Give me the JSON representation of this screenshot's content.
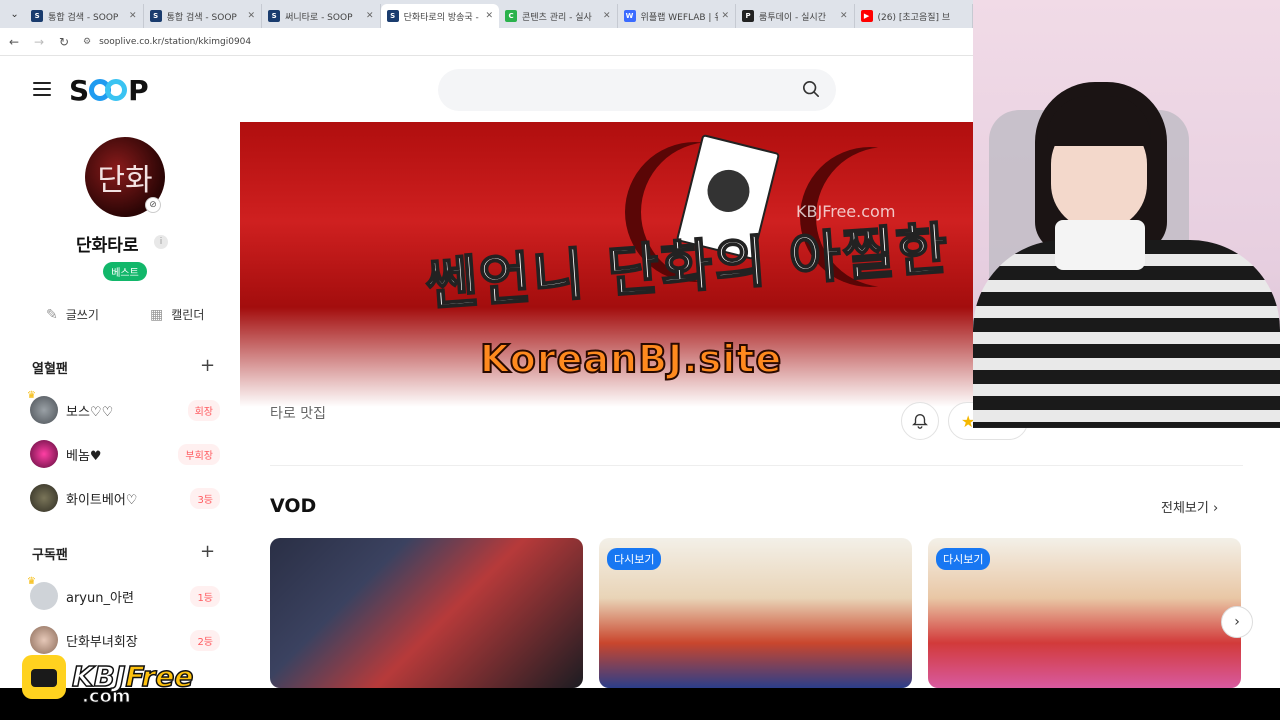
{
  "browser": {
    "tabs": [
      {
        "title": "통합 검색 - SOOP",
        "fav_color": "#1a3c6e",
        "fav_text": "S"
      },
      {
        "title": "통합 검색 - SOOP",
        "fav_color": "#1a3c6e",
        "fav_text": "S"
      },
      {
        "title": "써니타로 - SOOP",
        "fav_color": "#1a3c6e",
        "fav_text": "S"
      },
      {
        "title": "단화타로의 방송국 -",
        "fav_color": "#1a3c6e",
        "fav_text": "S"
      },
      {
        "title": "콘텐츠 관리 - 실사",
        "fav_color": "#2bb24c",
        "fav_text": "C"
      },
      {
        "title": "위플랩 WEFLAB | 유",
        "fav_color": "#3b6bff",
        "fav_text": "W"
      },
      {
        "title": "룸투데이 - 실시간",
        "fav_color": "#222222",
        "fav_text": "P"
      },
      {
        "title": "(26) [초고음질] 브",
        "fav_color": "#ff0000",
        "fav_text": "▶"
      }
    ],
    "url": "sooplive.co.kr/station/kkimgi0904"
  },
  "header": {
    "logo_text_s": "S",
    "logo_text_p": "P"
  },
  "profile": {
    "avatar_text": "단화",
    "name": "단화타로",
    "badge": "베스트",
    "write_label": "글쓰기",
    "calendar_label": "캘린더"
  },
  "fan_sections": {
    "hot_title": "열혈팬",
    "hot_members": [
      {
        "name": "보스♡♡",
        "rank": "회장"
      },
      {
        "name": "베놈♥",
        "rank": "부회장"
      },
      {
        "name": "화이트베어♡",
        "rank": "3등"
      }
    ],
    "sub_title": "구독팬",
    "sub_members": [
      {
        "name": "aryun_아련",
        "rank": "1등"
      },
      {
        "name": "단화부녀회장",
        "rank": "2등"
      }
    ]
  },
  "banner": {
    "title": "쎈언니 단화의 아찔한",
    "small_watermark": "KBJFree.com",
    "overlay_watermark": "KoreanBJ.site"
  },
  "station": {
    "tagline": "타로 맛집"
  },
  "vod": {
    "title": "VOD",
    "see_all": "전체보기",
    "replay_tag": "다시보기"
  },
  "bottom_logo": {
    "kbj": "KBJ",
    "free": "Free",
    "sub": ".com"
  },
  "colors": {
    "accent_blue": "#1f9bf0",
    "best_green": "#12b76a",
    "rank_red": "#ff5a5f",
    "banner_red": "#c81c1c"
  }
}
